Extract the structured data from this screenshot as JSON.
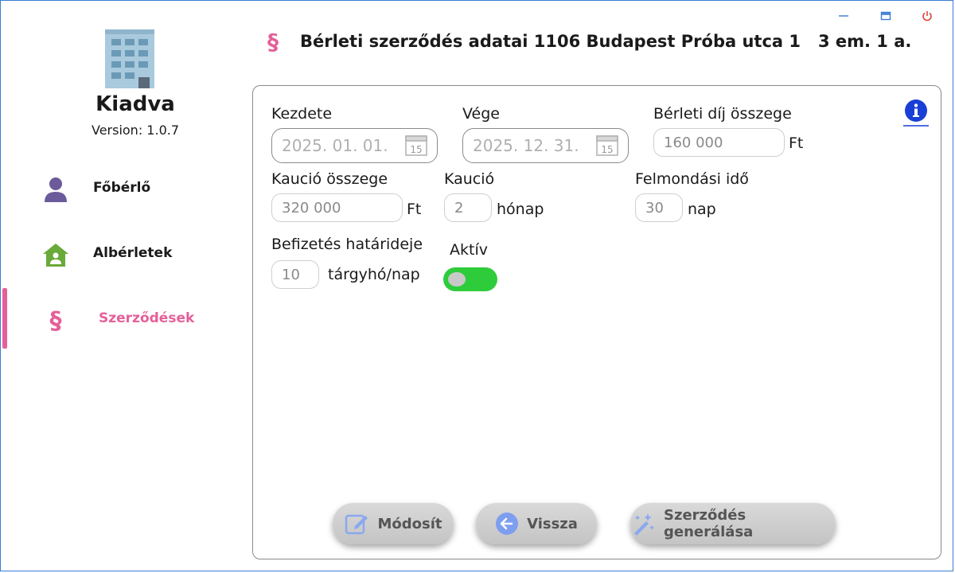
{
  "app": {
    "name": "Kiadva",
    "version": "Version: 1.0.7"
  },
  "window": {
    "minimize": "—",
    "maximize": "□",
    "close": "⏻"
  },
  "sidebar": {
    "items": [
      {
        "label": "Főbérlő",
        "icon": "person-icon",
        "active": false
      },
      {
        "label": "Albérletek",
        "icon": "house-icon",
        "active": false
      },
      {
        "label": "Szerződések",
        "icon": "section-icon",
        "active": true
      }
    ]
  },
  "header": {
    "icon": "§",
    "title": "Bérleti szerződés adatai 1106 Budapest Próba utca 1   3 em. 1 a."
  },
  "form": {
    "start": {
      "label": "Kezdete",
      "value": "2025. 01. 01."
    },
    "end": {
      "label": "Vége",
      "value": "2025. 12. 31."
    },
    "rent": {
      "label": "Bérleti díj összege",
      "value": "160 000",
      "unit": "Ft"
    },
    "deposit_amount": {
      "label": "Kaució összege",
      "value": "320 000",
      "unit": "Ft"
    },
    "deposit_months": {
      "label": "Kaució",
      "value": "2",
      "unit": "hónap"
    },
    "notice": {
      "label": "Felmondási idő",
      "value": "30",
      "unit": "nap"
    },
    "due": {
      "label": "Befizetés határideje",
      "value": "10",
      "unit": "tárgyhó/nap"
    },
    "active": {
      "label": "Aktív",
      "on": true
    },
    "calendar_day": "15"
  },
  "buttons": {
    "modify": "Módosít",
    "back": "Vissza",
    "generate": "Szerződés generálása"
  },
  "colors": {
    "accent": "#e4609a",
    "toggle_on": "#2ecc3a",
    "info": "#1a3fd6",
    "person_icon": "#6b5b9a",
    "house_icon": "#6aaa3a"
  }
}
